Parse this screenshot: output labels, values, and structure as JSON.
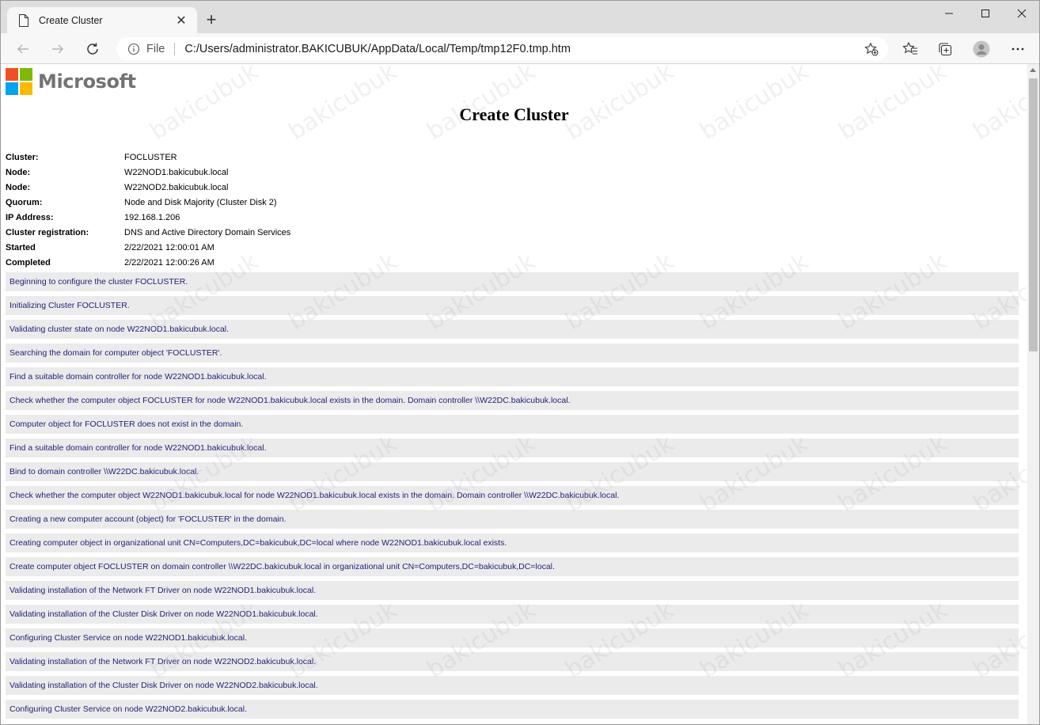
{
  "browser": {
    "tab_title": "Create Cluster",
    "tab_close": "✕",
    "new_tab": "+",
    "file_label": "File",
    "url": "C:/Users/administrator.BAKICUBUK/AppData/Local/Temp/tmp12F0.tmp.htm"
  },
  "page": {
    "logo_text": "Microsoft",
    "title": "Create Cluster",
    "properties": [
      {
        "key": "Cluster:",
        "value": "FOCLUSTER"
      },
      {
        "key": "Node:",
        "value": "W22NOD1.bakicubuk.local"
      },
      {
        "key": "Node:",
        "value": "W22NOD2.bakicubuk.local"
      },
      {
        "key": "Quorum:",
        "value": "Node and Disk Majority (Cluster Disk 2)"
      },
      {
        "key": "IP Address:",
        "value": "192.168.1.206"
      },
      {
        "key": "Cluster registration:",
        "value": "DNS and Active Directory Domain Services"
      },
      {
        "key": "Started",
        "value": "2/22/2021 12:00:01 AM"
      },
      {
        "key": "Completed",
        "value": "2/22/2021 12:00:26 AM"
      }
    ],
    "log": [
      "Beginning to configure the cluster FOCLUSTER.",
      "Initializing Cluster FOCLUSTER.",
      "Validating cluster state on node W22NOD1.bakicubuk.local.",
      "Searching the domain for computer object 'FOCLUSTER'.",
      "Find a suitable domain controller for node W22NOD1.bakicubuk.local.",
      "Check whether the computer object FOCLUSTER for node W22NOD1.bakicubuk.local exists in the domain. Domain controller \\\\W22DC.bakicubuk.local.",
      "Computer object for FOCLUSTER does not exist in the domain.",
      "Find a suitable domain controller for node W22NOD1.bakicubuk.local.",
      "Bind to domain controller \\\\W22DC.bakicubuk.local.",
      "Check whether the computer object W22NOD1.bakicubuk.local for node W22NOD1.bakicubuk.local exists in the domain. Domain controller \\\\W22DC.bakicubuk.local.",
      "Creating a new computer account (object) for 'FOCLUSTER' in the domain.",
      "Creating computer object in organizational unit CN=Computers,DC=bakicubuk,DC=local where node W22NOD1.bakicubuk.local exists.",
      "Create computer object FOCLUSTER on domain controller \\\\W22DC.bakicubuk.local in organizational unit CN=Computers,DC=bakicubuk,DC=local.",
      "Validating installation of the Network FT Driver on node W22NOD1.bakicubuk.local.",
      "Validating installation of the Cluster Disk Driver on node W22NOD1.bakicubuk.local.",
      "Configuring Cluster Service on node W22NOD1.bakicubuk.local.",
      "Validating installation of the Network FT Driver on node W22NOD2.bakicubuk.local.",
      "Validating installation of the Cluster Disk Driver on node W22NOD2.bakicubuk.local.",
      "Configuring Cluster Service on node W22NOD2.bakicubuk.local."
    ],
    "watermark": "bakicubuk"
  },
  "colors": {
    "log_background": "#ebebeb",
    "log_text": "#1f1f7a",
    "ms_red": "#f25022",
    "ms_green": "#7fba00",
    "ms_blue": "#00a4ef",
    "ms_yellow": "#ffb900"
  },
  "icons": [
    "page-icon",
    "close-icon",
    "plus-icon",
    "minimize-icon",
    "maximize-icon",
    "window-close-icon",
    "back-arrow-icon",
    "forward-arrow-icon",
    "refresh-icon",
    "info-icon",
    "add-favorite-icon",
    "favorites-icon",
    "collections-icon",
    "profile-icon",
    "more-icon"
  ]
}
